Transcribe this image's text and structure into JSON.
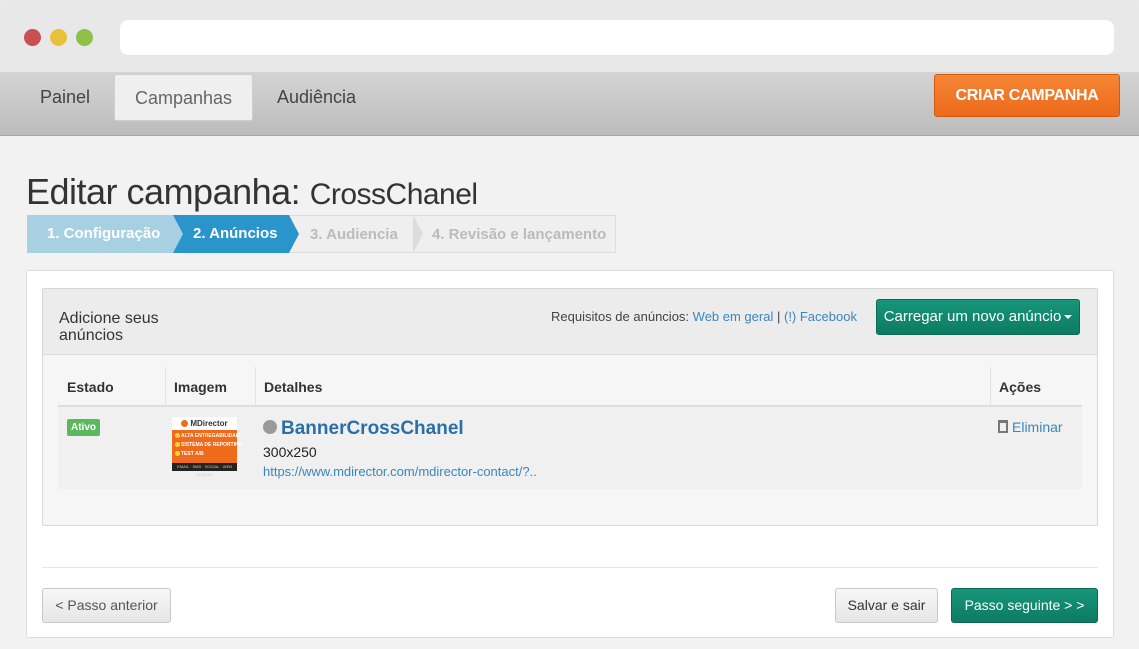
{
  "nav": {
    "items": [
      {
        "label": "Painel",
        "active": false
      },
      {
        "label": "Campanhas",
        "active": true
      },
      {
        "label": "Audiência",
        "active": false
      }
    ],
    "create_label": "CRIAR CAMPANHA",
    "create_color": "#ed6a1c"
  },
  "page": {
    "title_prefix": "Editar campanha:",
    "campaign_name": "CrossChanel"
  },
  "steps": [
    {
      "label": "1. Configuração",
      "state": "done"
    },
    {
      "label": "2. Anúncios",
      "state": "active"
    },
    {
      "label": "3. Audiencia",
      "state": "pending"
    },
    {
      "label": "4. Revisão e lançamento",
      "state": "pending"
    }
  ],
  "ads_panel": {
    "title": "Adicione seus anúncios",
    "requirements_label": "Requisitos de anúncios:",
    "link_web": "Web em geral",
    "separator": "|",
    "link_facebook": "(!) Facebook",
    "upload_label": "Carregar um novo anúncio",
    "accent_color": "#0d7b62"
  },
  "table": {
    "headers": [
      "Estado",
      "Imagem",
      "Detalhes",
      "Ações"
    ],
    "rows": [
      {
        "status": "Ativo",
        "name": "BannerCrossChanel",
        "size": "300x250",
        "url": "https://www.mdirector.com/mdirector-contact/?..",
        "action": "Eliminar",
        "thumb": {
          "brand": "MDirector",
          "lines": [
            "ALTA ENTREGABILIDAD",
            "SISTEMA DE REPORTING",
            "TEST A/B"
          ],
          "footer": "EMAIL · SMS · SOCIAL · WEB DISPLAY"
        }
      }
    ]
  },
  "footer": {
    "prev_label": "< Passo anterior",
    "save_label": "Salvar e sair",
    "next_label": "Passo seguinte > >"
  },
  "icons": {
    "globe": "globe-icon",
    "trash": "trash-icon",
    "caret": "caret-down-icon"
  }
}
